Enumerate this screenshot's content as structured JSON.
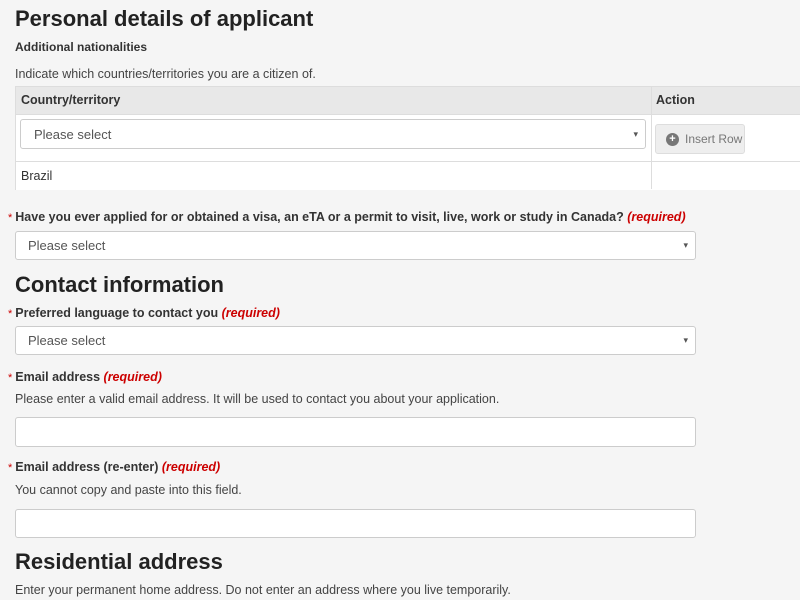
{
  "personal": {
    "title": "Personal details of applicant",
    "nationalities_heading": "Additional nationalities",
    "nationalities_hint": "Indicate which countries/territories you are a citizen of.",
    "table": {
      "col_country": "Country/territory",
      "col_action": "Action",
      "row_select_placeholder": "Please select",
      "insert_row_label": "Insert Row",
      "rows": [
        "Brazil"
      ]
    }
  },
  "visa_question": {
    "label": "Have you ever applied for or obtained a visa, an eTA or a permit to visit, live, work or study in Canada?",
    "required": "(required)",
    "value": "Please select"
  },
  "contact": {
    "title": "Contact information",
    "language_label": "Preferred language to contact you",
    "language_required": "(required)",
    "language_value": "Please select",
    "email_label": "Email address",
    "email_required": "(required)",
    "email_hint": "Please enter a valid email address. It will be used to contact you about your application.",
    "email_value": "",
    "email_reenter_label": "Email address (re-enter)",
    "email_reenter_required": "(required)",
    "email_reenter_hint": "You cannot copy and paste into this field.",
    "email_reenter_value": ""
  },
  "residential": {
    "title": "Residential address",
    "hint": "Enter your permanent home address. Do not enter an address where you live temporarily."
  },
  "ui": {
    "required_star": "*",
    "caret": "▾",
    "plus": "+",
    "colors": {
      "required": "#cc0000",
      "background": "#f5f5f5",
      "table_header": "#e8e8e8"
    }
  }
}
